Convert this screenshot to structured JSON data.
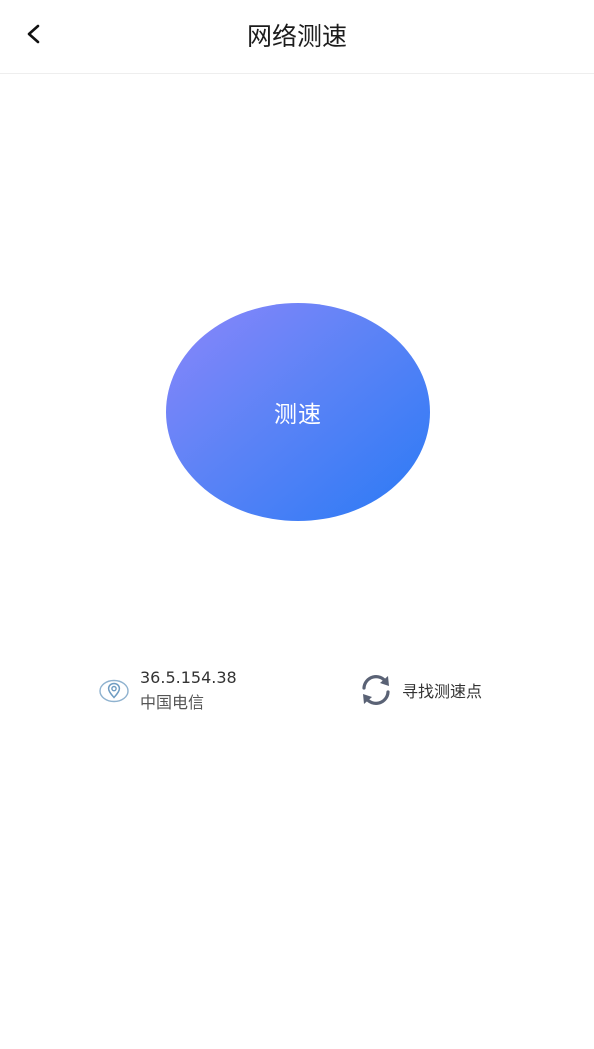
{
  "header": {
    "title": "网络测速",
    "back_icon": "chevron-left-icon"
  },
  "main": {
    "speed_test_label": "测速",
    "button_gradient": [
      "#8b86fb",
      "#2a7af5"
    ]
  },
  "location": {
    "icon": "location-pin-icon",
    "ip": "36.5.154.38",
    "isp": "中国电信"
  },
  "server": {
    "icon": "refresh-icon",
    "label": "寻找测速点"
  }
}
